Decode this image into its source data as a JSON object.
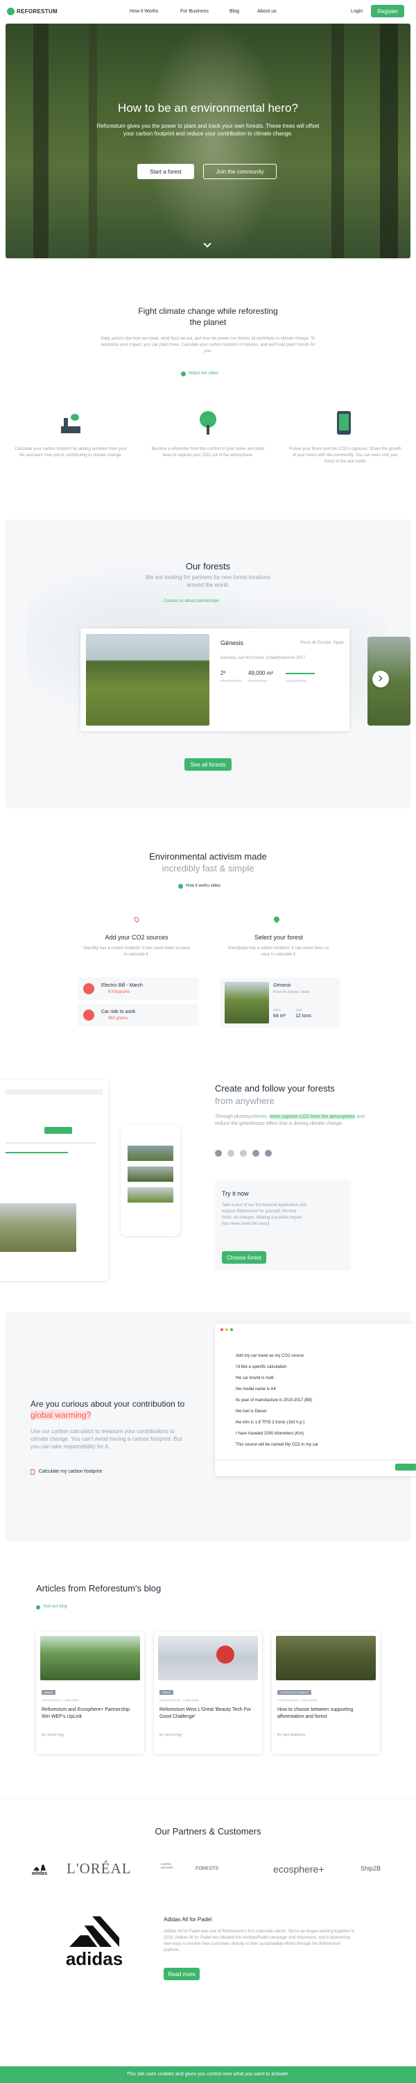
{
  "nav": {
    "brand": "REFORESTUM",
    "links": [
      "How it Works",
      "For Business",
      "Blog",
      "About us"
    ],
    "login": "Login",
    "register": "Register"
  },
  "hero": {
    "title": "How to be an environmental hero?",
    "text": "Reforestum gives you the power to plant and track your own forests. These trees will offset your carbon footprint and reduce your contribution to climate change.",
    "start_btn": "Start a forest",
    "join_btn": "Join the community"
  },
  "fight": {
    "title": "Fight climate change while reforesting the planet",
    "text": "Daily actions like how we travel, what food we eat, and how we power our homes all contribute to climate change. To neutralize your impact, you can plant trees. Calculate your carbon footprint in minutes, and we'll hold plant forests for you.",
    "watch": "Watch the video",
    "features": [
      "Calculate your carbon footprint by adding activities from your life and learn how you're contributing to climate change.",
      "Become a reforester from the comfort of your home and plant trees to capture your CO2 out of the atmosphere.",
      "Follow your forest and the CO2 it captures. Share the growth of your forest with the community. You can even visit your forest in the real world."
    ]
  },
  "forests": {
    "title": "Our forests",
    "subtitle": "We are looking for partners for new forest locations around the world.",
    "contact": "Contact us about partnerships",
    "card_title": "Génesis",
    "card_location": "Picos de Europa, Spain",
    "card_desc": "Génesis, our first forest. Crowdfunded in 2017.",
    "stat1": "2º",
    "stat1_label": "REFORESTERS",
    "stat2": "49,000 m²",
    "stat2_label": "REFORESTED",
    "stat3_label": "DATA ARRIVING",
    "see_all": "See all forests"
  },
  "activism": {
    "title": "Environmental activism made",
    "subtitle": "incredibly fast & simple",
    "how": "How it works video",
    "col1_title": "Add your CO2 sources",
    "col1_text": "Standby has a carbon footprint. It has never been so easy to calculate it.",
    "col2_title": "Select your forest",
    "col2_text": "Everybody has a carbon footprint. It has never been so easy to calculate it.",
    "source1": "Electric Bill - March",
    "source1_val": "8 Kilograms",
    "source2": "Car ride to work",
    "source2_val": "960 grams",
    "forest_name": "Génesis",
    "forest_loc": "Picos de Europa, Spain",
    "forest_area_label": "AREA",
    "forest_area": "64 m²",
    "forest_time_label": "TIME",
    "forest_time": "12 tons"
  },
  "follow": {
    "title": "Create and follow your forests",
    "subtitle": "from anywhere",
    "text_pre": "Through photosynthesis,",
    "text_highlight": "trees capture CO2 from the atmosphere",
    "text_post": "and reduce the greenhouse effect that is driving climate change.",
    "try_title": "Try it now",
    "try_text": "Take a tour of our full featured application and explore Reforestum for yourself. No time limits, no charges. Making a positive impact has never been this easy!",
    "choose_btn": "Choose forest"
  },
  "curious": {
    "title_pre": "Are you curious about your contribution to",
    "title_highlight": "global warming?",
    "text": "Use our carbon calculator to measure your contributions to climate change. You can't avoid having a carbon footprint. But you can take responsibility for it.",
    "link": "Calculate my carbon footprint",
    "form_lines": [
      "Add my car travel as my CO2 source",
      "I'd like a specific calculation",
      "the car brand is Audi",
      "the model name is A4",
      "its year of manufacture is 2010-2017 (B8)",
      "the fuel is Diesel",
      "the trim is 1.8 TFSI 2 tronic (163 h.p.)",
      "I have traveled 2000 kilometers (Km)",
      "This source will be named My CO2 in my car"
    ]
  },
  "blog": {
    "title": "Articles from Reforestum's blog",
    "visit": "Visit our blog",
    "articles": [
      {
        "tag": "NEWS",
        "meta": "1 MONTH AGO · 3 MIN READ",
        "title": "Reforestum and Ecosphere+ Partnership Win WEF's UpLink",
        "author": "By Jenna Figg"
      },
      {
        "tag": "NEWS",
        "meta": "2 MONTHS AGO · 3 MIN READ",
        "title": "Reforestum Wins L'Oreal 'Beauty Tech For Good Challenge'",
        "author": "By Jenna Figg"
      },
      {
        "tag": "TO PROJECT BASICS",
        "meta": "3 MONTHS AGO · 5 MIN READ",
        "title": "How to choose between supporting afforestation and forest",
        "author": "By Sam Matthews"
      }
    ]
  },
  "partners": {
    "title": "Our Partners & Customers",
    "logos": [
      "adidas",
      "L'ORÉAL",
      "UNITED NATIONS",
      "FORESTS",
      "ecosphere+",
      "Ship2B"
    ],
    "feature_title": "Adidas All for Padel",
    "feature_text": "Adidas All for Padel was one of Reforestum's first corporate clients. Since we began working together in 2019, Adidas All for Padel has initiated the #AdidasPadel campaign and movement, and is pioneering new ways to involve their customers directly in their sustainability efforts through the Reforestum platform.",
    "feature_btn": "Read more",
    "big_logo": "adidas"
  },
  "cookie": {
    "text": "This site uses cookies and gives you control over what you want to activate."
  },
  "colors": {
    "accent": "#3db56c",
    "highlight": "#f25c54",
    "dark": "#1f2b3a"
  }
}
